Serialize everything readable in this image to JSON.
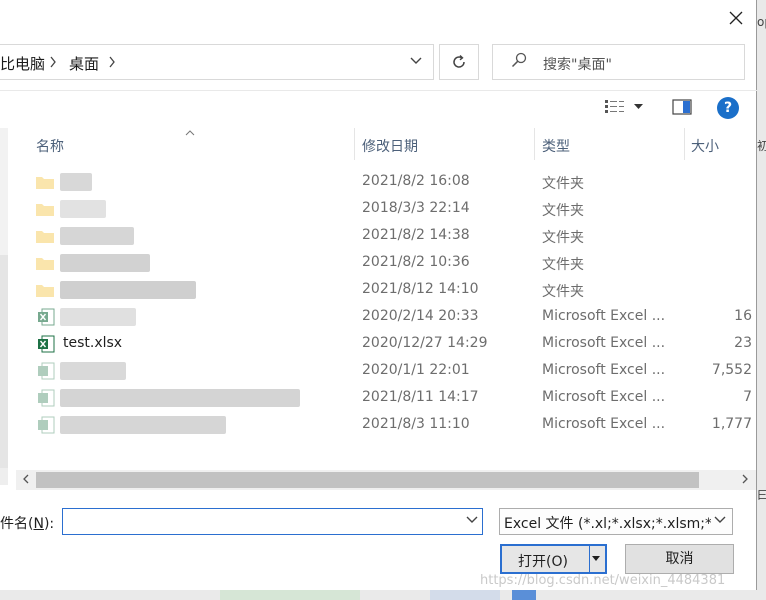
{
  "address": {
    "crumbs": [
      "比电脑",
      "桌面"
    ],
    "separator": ">"
  },
  "search": {
    "placeholder": "搜索\"桌面\""
  },
  "toolbar": {
    "help_label": "?"
  },
  "columns": {
    "name": "名称",
    "modified": "修改日期",
    "type": "类型",
    "size": "大小"
  },
  "files": [
    {
      "name": "",
      "modified": "2021/8/2 16:08",
      "type": "文件夹",
      "size": "",
      "icon": "folder-icon"
    },
    {
      "name": "",
      "modified": "2018/3/3 22:14",
      "type": "文件夹",
      "size": "",
      "icon": "folder-icon"
    },
    {
      "name": "",
      "modified": "2021/8/2 14:38",
      "type": "文件夹",
      "size": "",
      "icon": "folder-icon"
    },
    {
      "name": "",
      "modified": "2021/8/2 10:36",
      "type": "文件夹",
      "size": "",
      "icon": "folder-icon"
    },
    {
      "name": "",
      "modified": "2021/8/12 14:10",
      "type": "文件夹",
      "size": "",
      "icon": "folder-icon"
    },
    {
      "name": "",
      "modified": "2020/2/14 20:33",
      "type": "Microsoft Excel ...",
      "size": "16",
      "icon": "excel-file-icon"
    },
    {
      "name": "test.xlsx",
      "modified": "2020/12/27 14:29",
      "type": "Microsoft Excel ...",
      "size": "23",
      "icon": "excel-file-icon"
    },
    {
      "name": "",
      "modified": "2020/1/1 22:01",
      "type": "Microsoft Excel ...",
      "size": "7,552",
      "icon": "excel-file-icon"
    },
    {
      "name": "",
      "modified": "2021/8/11 14:17",
      "type": "Microsoft Excel ...",
      "size": "7",
      "icon": "excel-file-icon"
    },
    {
      "name": "",
      "modified": "2021/8/3 11:10",
      "type": "Microsoft Excel ...",
      "size": "1,777",
      "icon": "excel-file-icon"
    }
  ],
  "footer": {
    "filename_label_prefix": "件名(",
    "filename_label_key": "N",
    "filename_label_suffix": "):",
    "filename_value": "",
    "filetype_value": "Excel 文件 (*.xl;*.xlsx;*.xlsm;*.",
    "open_label": "打开(O)",
    "cancel_label": "取消"
  },
  "watermark": "https://blog.csdn.net/weixin_4484381",
  "background_marks": [
    "op",
    "初",
    "曰"
  ],
  "colors": {
    "accent": "#2b6fd0",
    "help": "#1a6fc9",
    "excel": "#1e7145",
    "folder": "#f5c74a"
  }
}
